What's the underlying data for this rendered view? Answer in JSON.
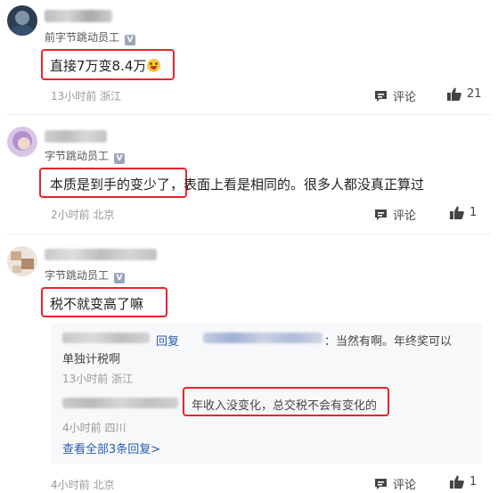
{
  "comments": [
    {
      "author_title": "前字节跳动员工",
      "text": "直接7万变8.4万",
      "meta": "13小时前 浙江",
      "comment_label": "评论",
      "like_count": "21"
    },
    {
      "author_title": "字节跳动员工",
      "text_highlighted": "本质是到手的变少了，",
      "text_rest": "表面上看是相同的。很多人都没真正算过",
      "meta": "2小时前 北京",
      "comment_label": "评论",
      "like_count": "1"
    },
    {
      "author_title": "字节跳动员工",
      "text": "税不就变高了嘛",
      "meta": "4小时前 北京",
      "comment_label": "评论",
      "like_count": "1",
      "replies": [
        {
          "reply_word": "回复",
          "reply_target_prefix": "：",
          "text_line1": "当然有啊。年终奖可以",
          "text_line2": "单独计税啊",
          "meta": "13小时前 浙江"
        },
        {
          "text": "年收入没变化，总交税不会有变化的",
          "meta": "4小时前 四川"
        }
      ],
      "view_all": "查看全部3条回复>"
    }
  ],
  "verified_badge": "V",
  "colors": {
    "highlight": "#e8242b",
    "link": "#2a5db0",
    "meta": "#999999"
  },
  "icons": {
    "comment": "comment-icon",
    "like": "thumbs-up-icon"
  }
}
